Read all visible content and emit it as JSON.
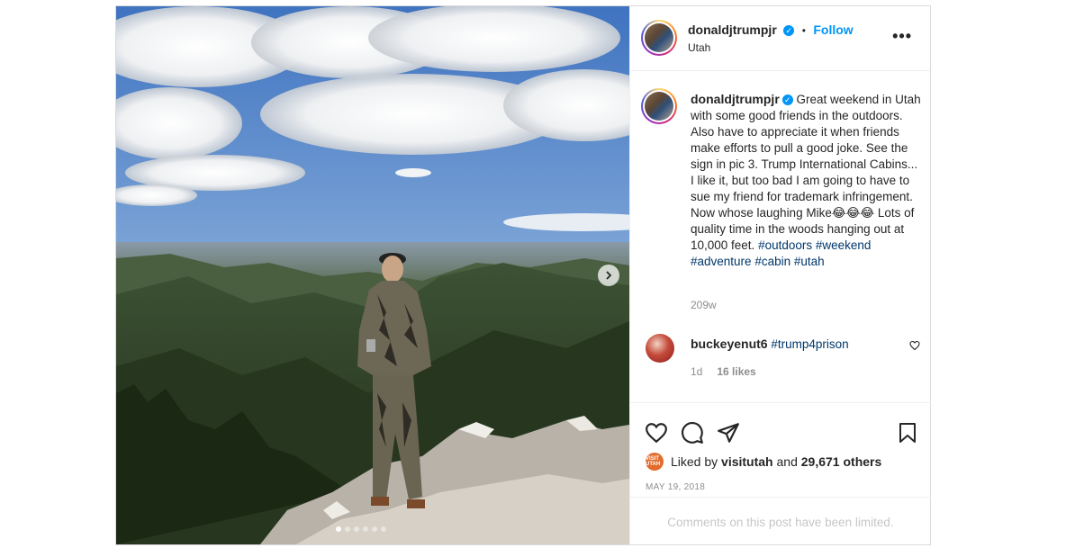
{
  "post": {
    "username": "donaldjtrumpjr",
    "verified_icon": "verified-badge-icon",
    "follow_label": "Follow",
    "separator": "•",
    "location": "Utah",
    "more_label": "•••",
    "caption": {
      "text_main": "Great weekend in Utah with some good friends in the outdoors. Also have to appreciate it when friends make efforts to pull a good joke. See the sign in pic 3. Trump International Cabins... I like it, but too bad I am going to have to sue my friend for trademark infringement. Now whose laughing Mike😂😂😂 Lots of quality time in the woods hanging out at 10,000 feet.",
      "hashtags": [
        "#outdoors",
        "#weekend",
        "#adventure",
        "#cabin",
        "#utah"
      ],
      "time": "209w"
    },
    "comments": [
      {
        "username": "buckeyenut6",
        "text": "#trump4prison",
        "time": "1d",
        "likes": "16 likes"
      }
    ],
    "likes": {
      "prefix": "Liked by",
      "user": "visitutah",
      "and": "and",
      "others": "29,671 others",
      "avatar_text": "VISIT UTAH"
    },
    "date": "MAY 19, 2018",
    "comments_limited": "Comments on this post have been limited."
  },
  "media": {
    "image_count": 6,
    "active_index": 0
  },
  "colors": {
    "accent": "#0095f6",
    "hashtag": "#00376b",
    "muted": "#8e8e8e",
    "border": "#dbdbdb"
  }
}
